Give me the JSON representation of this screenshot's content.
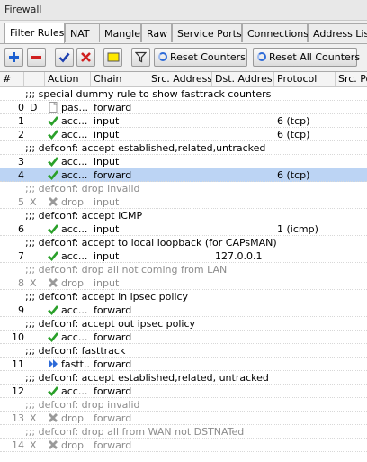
{
  "window": {
    "title": "Firewall"
  },
  "tabs": [
    {
      "label": "Filter Rules",
      "active": true
    },
    {
      "label": "NAT"
    },
    {
      "label": "Mangle"
    },
    {
      "label": "Raw"
    },
    {
      "label": "Service Ports"
    },
    {
      "label": "Connections"
    },
    {
      "label": "Address Lists"
    }
  ],
  "toolbar": {
    "icons": [
      "add-icon",
      "remove-icon",
      "enable-icon",
      "disable-icon",
      "comment-icon",
      "filter-icon"
    ],
    "reset_counters": "Reset Counters",
    "reset_all_counters": "Reset All Counters"
  },
  "columns": [
    "#",
    "",
    "Action",
    "Chain",
    "Src. Address",
    "Dst. Address",
    "Protocol",
    "Src. Port"
  ],
  "rows": [
    {
      "type": "comment",
      "text": ";;; special dummy rule to show fasttrack counters"
    },
    {
      "type": "rule",
      "num": "0",
      "flag": "D",
      "action": "pas...",
      "action_icon": "passthrough",
      "chain": "forward",
      "src": "",
      "dst": "",
      "proto": ""
    },
    {
      "type": "rule",
      "num": "1",
      "flag": "",
      "action": "acc...",
      "action_icon": "accept",
      "chain": "input",
      "src": "",
      "dst": "",
      "proto": "6 (tcp)"
    },
    {
      "type": "rule",
      "num": "2",
      "flag": "",
      "action": "acc...",
      "action_icon": "accept",
      "chain": "input",
      "src": "",
      "dst": "",
      "proto": "6 (tcp)"
    },
    {
      "type": "comment",
      "text": ";;; defconf: accept established,related,untracked"
    },
    {
      "type": "rule",
      "num": "3",
      "flag": "",
      "action": "acc...",
      "action_icon": "accept",
      "chain": "input",
      "src": "",
      "dst": "",
      "proto": ""
    },
    {
      "type": "rule",
      "num": "4",
      "flag": "",
      "action": "acc...",
      "action_icon": "accept",
      "chain": "forward",
      "src": "",
      "dst": "",
      "proto": "6 (tcp)",
      "selected": true
    },
    {
      "type": "comment",
      "text": ";;; defconf: drop invalid",
      "disabled": true
    },
    {
      "type": "rule",
      "num": "5",
      "flag": "X",
      "action": "drop",
      "action_icon": "drop",
      "chain": "input",
      "src": "",
      "dst": "",
      "proto": "",
      "disabled": true
    },
    {
      "type": "comment",
      "text": ";;; defconf: accept ICMP"
    },
    {
      "type": "rule",
      "num": "6",
      "flag": "",
      "action": "acc...",
      "action_icon": "accept",
      "chain": "input",
      "src": "",
      "dst": "",
      "proto": "1 (icmp)"
    },
    {
      "type": "comment",
      "text": ";;; defconf: accept to local loopback (for CAPsMAN)"
    },
    {
      "type": "rule",
      "num": "7",
      "flag": "",
      "action": "acc...",
      "action_icon": "accept",
      "chain": "input",
      "src": "",
      "dst": "127.0.0.1",
      "proto": ""
    },
    {
      "type": "comment",
      "text": ";;; defconf: drop all not coming from LAN",
      "disabled": true
    },
    {
      "type": "rule",
      "num": "8",
      "flag": "X",
      "action": "drop",
      "action_icon": "drop",
      "chain": "input",
      "src": "",
      "dst": "",
      "proto": "",
      "disabled": true
    },
    {
      "type": "comment",
      "text": ";;; defconf: accept in ipsec policy"
    },
    {
      "type": "rule",
      "num": "9",
      "flag": "",
      "action": "acc...",
      "action_icon": "accept",
      "chain": "forward",
      "src": "",
      "dst": "",
      "proto": ""
    },
    {
      "type": "comment",
      "text": ";;; defconf: accept out ipsec policy"
    },
    {
      "type": "rule",
      "num": "10",
      "flag": "",
      "action": "acc...",
      "action_icon": "accept",
      "chain": "forward",
      "src": "",
      "dst": "",
      "proto": ""
    },
    {
      "type": "comment",
      "text": ";;; defconf: fasttrack"
    },
    {
      "type": "rule",
      "num": "11",
      "flag": "",
      "action": "fastt...",
      "action_icon": "fasttrack",
      "chain": "forward",
      "src": "",
      "dst": "",
      "proto": ""
    },
    {
      "type": "comment",
      "text": ";;; defconf: accept established,related, untracked"
    },
    {
      "type": "rule",
      "num": "12",
      "flag": "",
      "action": "acc...",
      "action_icon": "accept",
      "chain": "forward",
      "src": "",
      "dst": "",
      "proto": ""
    },
    {
      "type": "comment",
      "text": ";;; defconf: drop invalid",
      "disabled": true
    },
    {
      "type": "rule",
      "num": "13",
      "flag": "X",
      "action": "drop",
      "action_icon": "drop",
      "chain": "forward",
      "src": "",
      "dst": "",
      "proto": "",
      "disabled": true
    },
    {
      "type": "comment",
      "text": ";;; defconf: drop all from WAN not DSTNATed",
      "disabled": true
    },
    {
      "type": "rule",
      "num": "14",
      "flag": "X",
      "action": "drop",
      "action_icon": "drop",
      "chain": "forward",
      "src": "",
      "dst": "",
      "proto": "",
      "disabled": true
    }
  ],
  "colors": {
    "selected_row": "#bcd4f4",
    "accept": "#2aa02a",
    "drop": "#9a9a9a",
    "fasttrack": "#2d6ad8",
    "disabled_text": "#8c8c8c"
  }
}
